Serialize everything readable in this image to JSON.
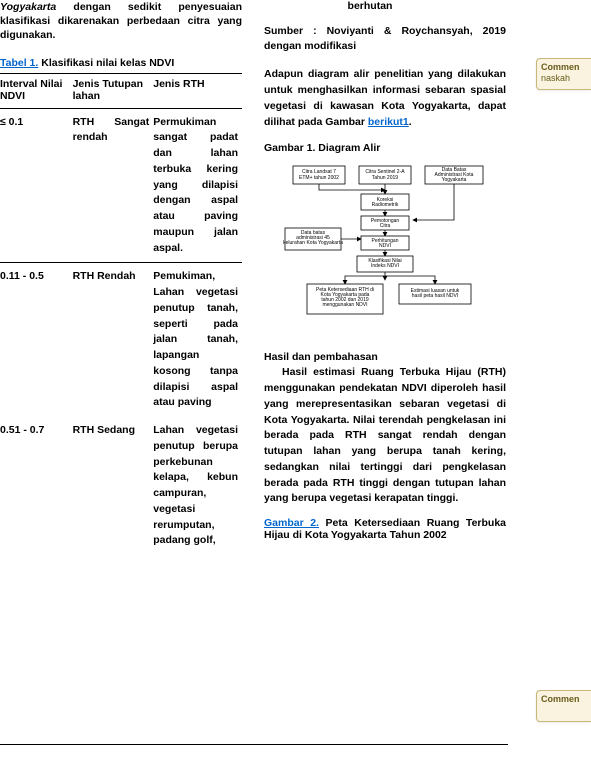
{
  "leftColumn": {
    "intro_prefix_italic": "Yogyakarta",
    "intro_rest": " dengan sedikit penyesuaian klasifikasi dikarenakan perbedaan citra yang digunakan.",
    "table_caption_link": "Tabel 1.",
    "table_caption_rest": " Klasifikasi nilai kelas NDVI",
    "headers": {
      "c1": "Interval Nilai NDVI",
      "c2": "Jenis Tutupan lahan",
      "c3": "Jenis RTH"
    },
    "rows": [
      {
        "c1": "≤ 0.1",
        "c2": "RTH Sangat rendah",
        "c3": "Permukiman sangat padat dan lahan terbuka kering yang dilapisi dengan aspal atau paving maupun jalan aspal."
      },
      {
        "c1": "0.11 - 0.5",
        "c2": "RTH Rendah",
        "c3": "Pemukiman, Lahan vegetasi penutup tanah, seperti pada jalan tanah, lapangan kosong tanpa dilapisi aspal atau paving"
      },
      {
        "c1": "0.51 - 0.7",
        "c2": "RTH Sedang",
        "c3": "Lahan vegetasi penutup berupa perkebunan kelapa, kebun campuran, vegetasi rerumputan, padang golf,"
      }
    ]
  },
  "rightColumn": {
    "berhutan": "berhutan",
    "source": "Sumber : Noviyanti & Roychansyah, 2019 dengan modifikasi",
    "para1_a": "Adapun diagram alir penelitian yang dilakukan untuk menghasilkan informasi sebaran spasial vegetasi di kawasan Kota Yogyakarta, dapat dilihat pada Gambar ",
    "para1_link": "berikut1",
    "para1_b": ".",
    "fig1_caption": "Gambar 1. Diagram Alir",
    "diagram": {
      "b1": "Citra Landsat 7 ETM+ tahun 2002",
      "b2": "Citra Sentinel 2-A Tahun 2019",
      "b3": "Data Batas Administrasi Kota Yogyakarta",
      "b4": "Koreksi Radiometrik",
      "b5": "Pemotongan Citra",
      "bSide": "Data batas administrasi 45 kelurahan Kota Yogyakarta",
      "b6": "Perhitungan NDVI",
      "b7": "Klasifikasi Nilai Indeks NDVI",
      "b8": "Peta Ketersediaan RTH di Kota Yogyakarta pada tahun 2002 dan 2019 menggunakan NDVI",
      "b9": "Estimasi luasan untuk hasil peta hasil NDVI"
    },
    "subhead": "Hasil dan pembahasan",
    "body": "Hasil estimasi Ruang Terbuka Hijau (RTH) menggunakan pendekatan NDVI diperoleh hasil yang merepresentasikan sebaran vegetasi di Kota Yogyakarta. Nilai terendah pengkelasan ini berada pada RTH sangat rendah dengan tutupan lahan yang berupa tanah kering, sedangkan nilai tertinggi dari pengkelasan berada pada RTH tinggi dengan tutupan lahan yang berupa vegetasi kerapatan tinggi.",
    "fig2_link": "Gambar 2.",
    "fig2_rest": " Peta Ketersediaan Ruang Terbuka Hijau di Kota Yogyakarta Tahun 2002"
  },
  "comments": {
    "c1_head": "Commen",
    "c1_body": "naskah",
    "c2_head": "Commen",
    "c2_body": ""
  }
}
